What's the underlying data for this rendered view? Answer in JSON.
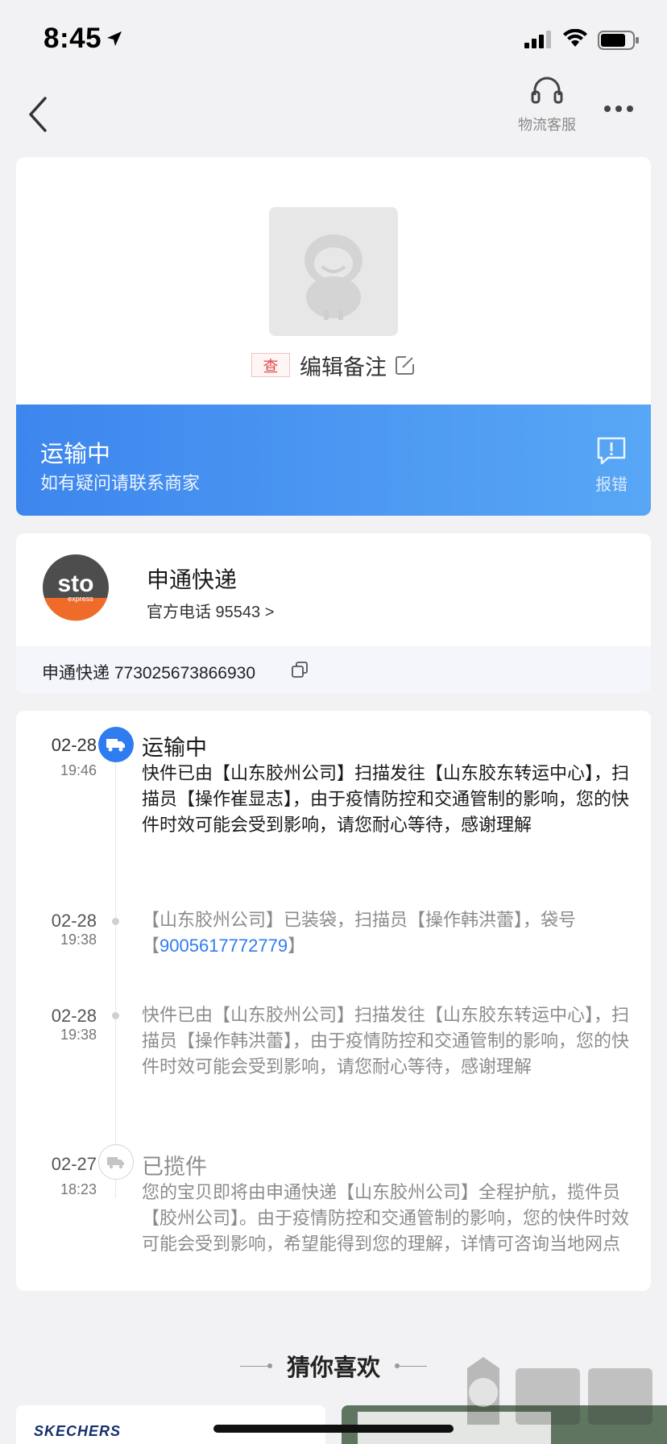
{
  "status_bar": {
    "time": "8:45"
  },
  "nav": {
    "customer_service_label": "物流客服"
  },
  "order": {
    "badge": "查",
    "remark_label": "编辑备注",
    "status_title": "运输中",
    "status_subtitle": "如有疑问请联系商家",
    "report_label": "报错"
  },
  "courier": {
    "name": "申通快递",
    "phone_text": "官方电话 95543 >",
    "tracking_text": "申通快递 773025673866930"
  },
  "timeline": {
    "events": [
      {
        "date": "02-28",
        "time": "19:46",
        "title": "运输中",
        "desc": "快件已由【山东胶州公司】扫描发往【山东胶东转运中心】，扫描员【操作崔显志】，由于疫情防控和交通管制的影响，您的快件时效可能会受到影响，请您耐心等待，感谢理解"
      },
      {
        "date": "02-28",
        "time": "19:38",
        "desc_pre": "【山东胶州公司】已装袋，扫描员【操作韩洪蕾】，袋号【",
        "desc_link": "9005617772779",
        "desc_post": "】"
      },
      {
        "date": "02-28",
        "time": "19:38",
        "desc": "快件已由【山东胶州公司】扫描发往【山东胶东转运中心】，扫描员【操作韩洪蕾】，由于疫情防控和交通管制的影响，您的快件时效可能会受到影响，请您耐心等待，感谢理解"
      },
      {
        "date": "02-27",
        "time": "18:23",
        "title": "已揽件",
        "desc": "您的宝贝即将由申通快递【山东胶州公司】全程护航，揽件员【胶州公司】。由于疫情防控和交通管制的影响，您的快件时效可能会受到影响，希望能得到您的理解，详情可咨询当地网点"
      }
    ]
  },
  "recommend": {
    "title": "猜你喜欢"
  },
  "products": {
    "first_brand": "SKECHERS"
  },
  "colors": {
    "accent": "#3d86ee",
    "banner_end": "#58a7f5",
    "link": "#2f7cf0",
    "badge_red": "#e04a4a"
  }
}
